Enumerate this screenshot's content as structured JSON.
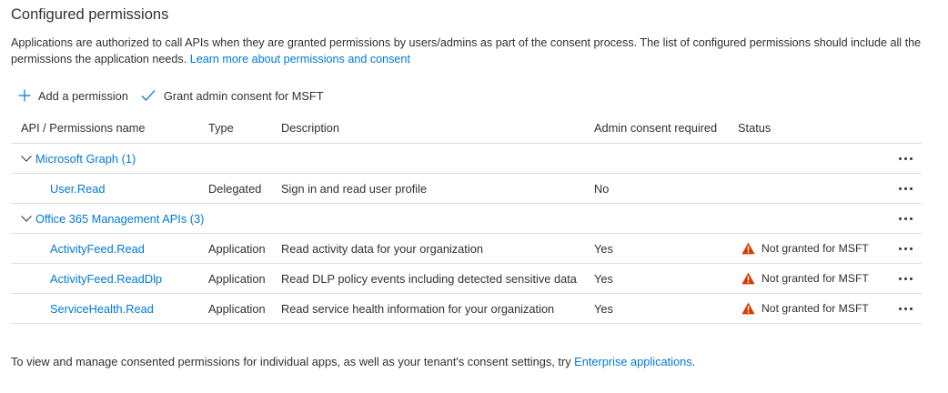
{
  "section": {
    "title": "Configured permissions",
    "description": "Applications are authorized to call APIs when they are granted permissions by users/admins as part of the consent process. The list of configured permissions should include all the permissions the application needs.",
    "learn_more": "Learn more about permissions and consent"
  },
  "toolbar": {
    "add_label": "Add a permission",
    "grant_label": "Grant admin consent for MSFT"
  },
  "table": {
    "headers": {
      "name": "API / Permissions name",
      "type": "Type",
      "description": "Description",
      "admin": "Admin consent required",
      "status": "Status"
    },
    "groups": [
      {
        "label": "Microsoft Graph (1)",
        "permissions": [
          {
            "name": "User.Read",
            "type": "Delegated",
            "description": "Sign in and read user profile",
            "admin": "No",
            "status": ""
          }
        ]
      },
      {
        "label": "Office 365 Management APIs (3)",
        "permissions": [
          {
            "name": "ActivityFeed.Read",
            "type": "Application",
            "description": "Read activity data for your organization",
            "admin": "Yes",
            "status": "Not granted for MSFT"
          },
          {
            "name": "ActivityFeed.ReadDlp",
            "type": "Application",
            "description": "Read DLP policy events including detected sensitive data",
            "admin": "Yes",
            "status": "Not granted for MSFT"
          },
          {
            "name": "ServiceHealth.Read",
            "type": "Application",
            "description": "Read service health information for your organization",
            "admin": "Yes",
            "status": "Not granted for MSFT"
          }
        ]
      }
    ]
  },
  "footer": {
    "text": "To view and manage consented permissions for individual apps, as well as your tenant's consent settings, try",
    "link": "Enterprise applications",
    "suffix": "."
  },
  "colors": {
    "link": "#0078d4",
    "text": "#323130",
    "warning": "#d83b01",
    "divider": "#e1dfdd"
  },
  "icons": {
    "add": "plus-icon",
    "grant": "checkmark-icon",
    "expand": "chevron-down-icon",
    "warning": "warning-icon",
    "more": "more-actions-icon"
  }
}
